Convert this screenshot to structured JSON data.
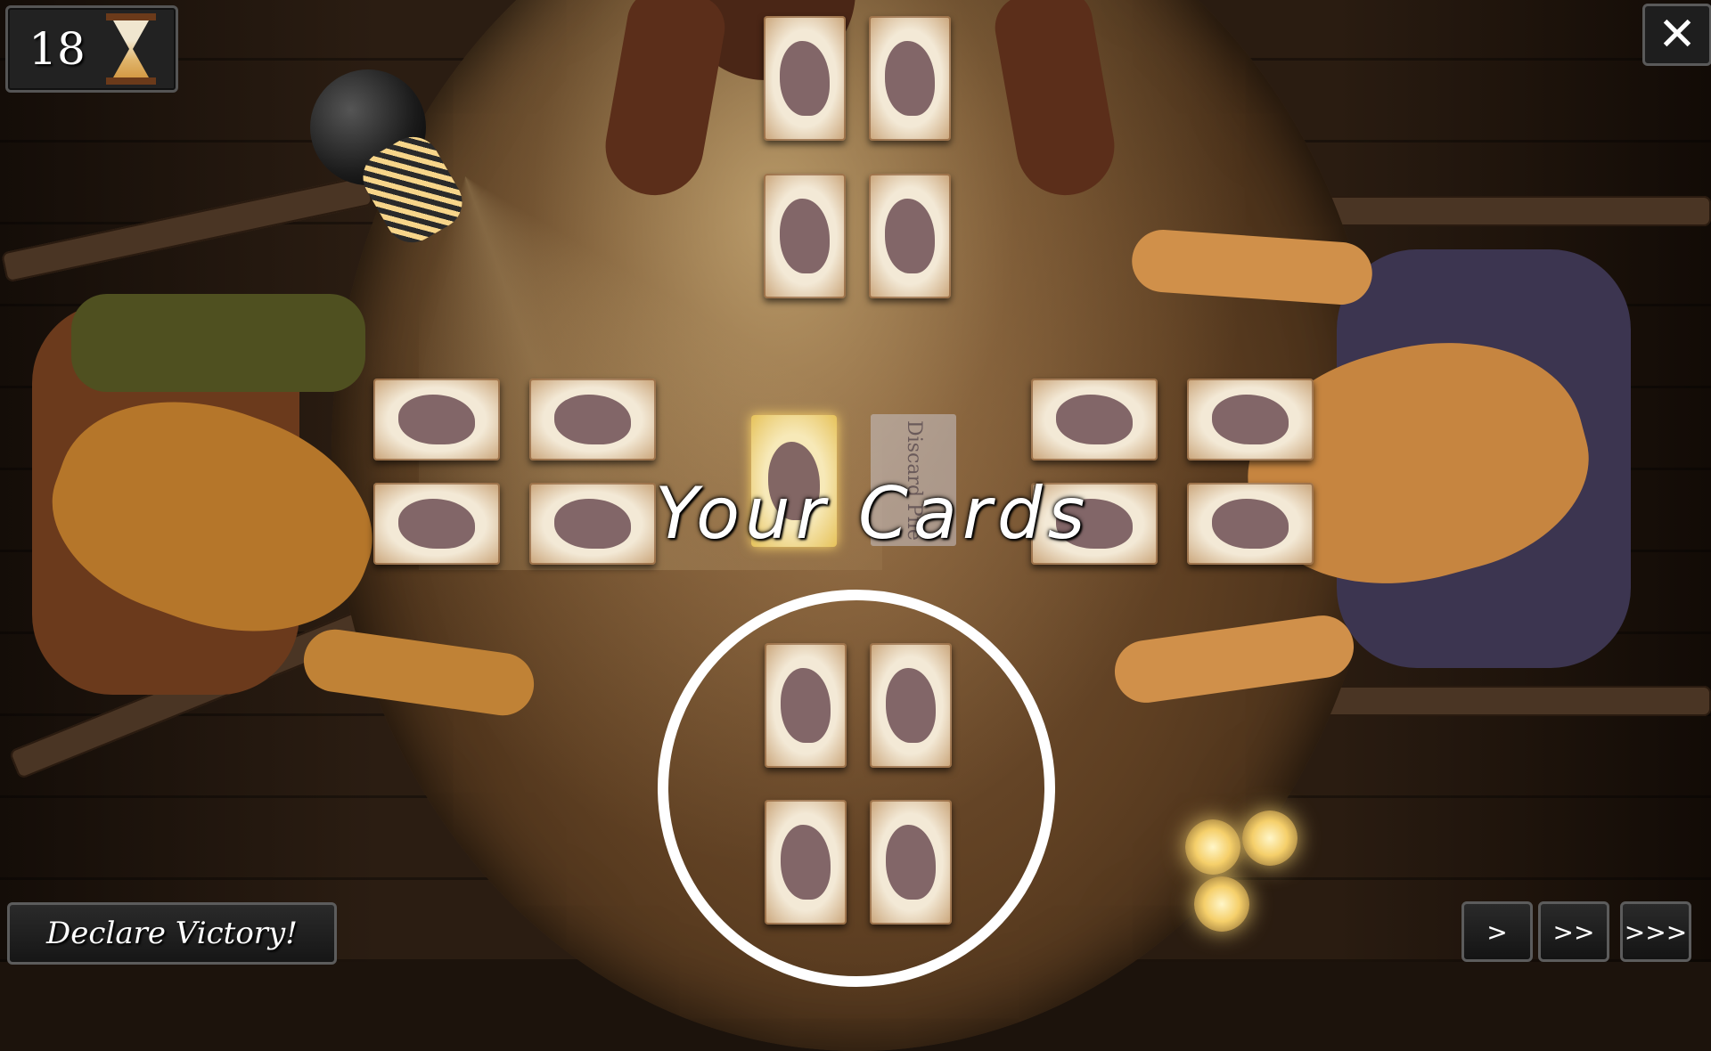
{
  "hud": {
    "timer_value": "18",
    "timer_icon": "hourglass-icon",
    "close_icon": "close-icon",
    "close_label": "✕"
  },
  "table": {
    "your_cards_label": "Your Cards",
    "discard_pile_label": "Discard Pile"
  },
  "controls": {
    "declare_victory_label": "Declare Victory!",
    "speed_buttons": [
      ">",
      ">>",
      ">>>"
    ]
  },
  "colors": {
    "table_wood": "#5e3f22",
    "card_face": "#efe3cf",
    "highlight": "#e6c25a",
    "ring": "#ffffff"
  }
}
